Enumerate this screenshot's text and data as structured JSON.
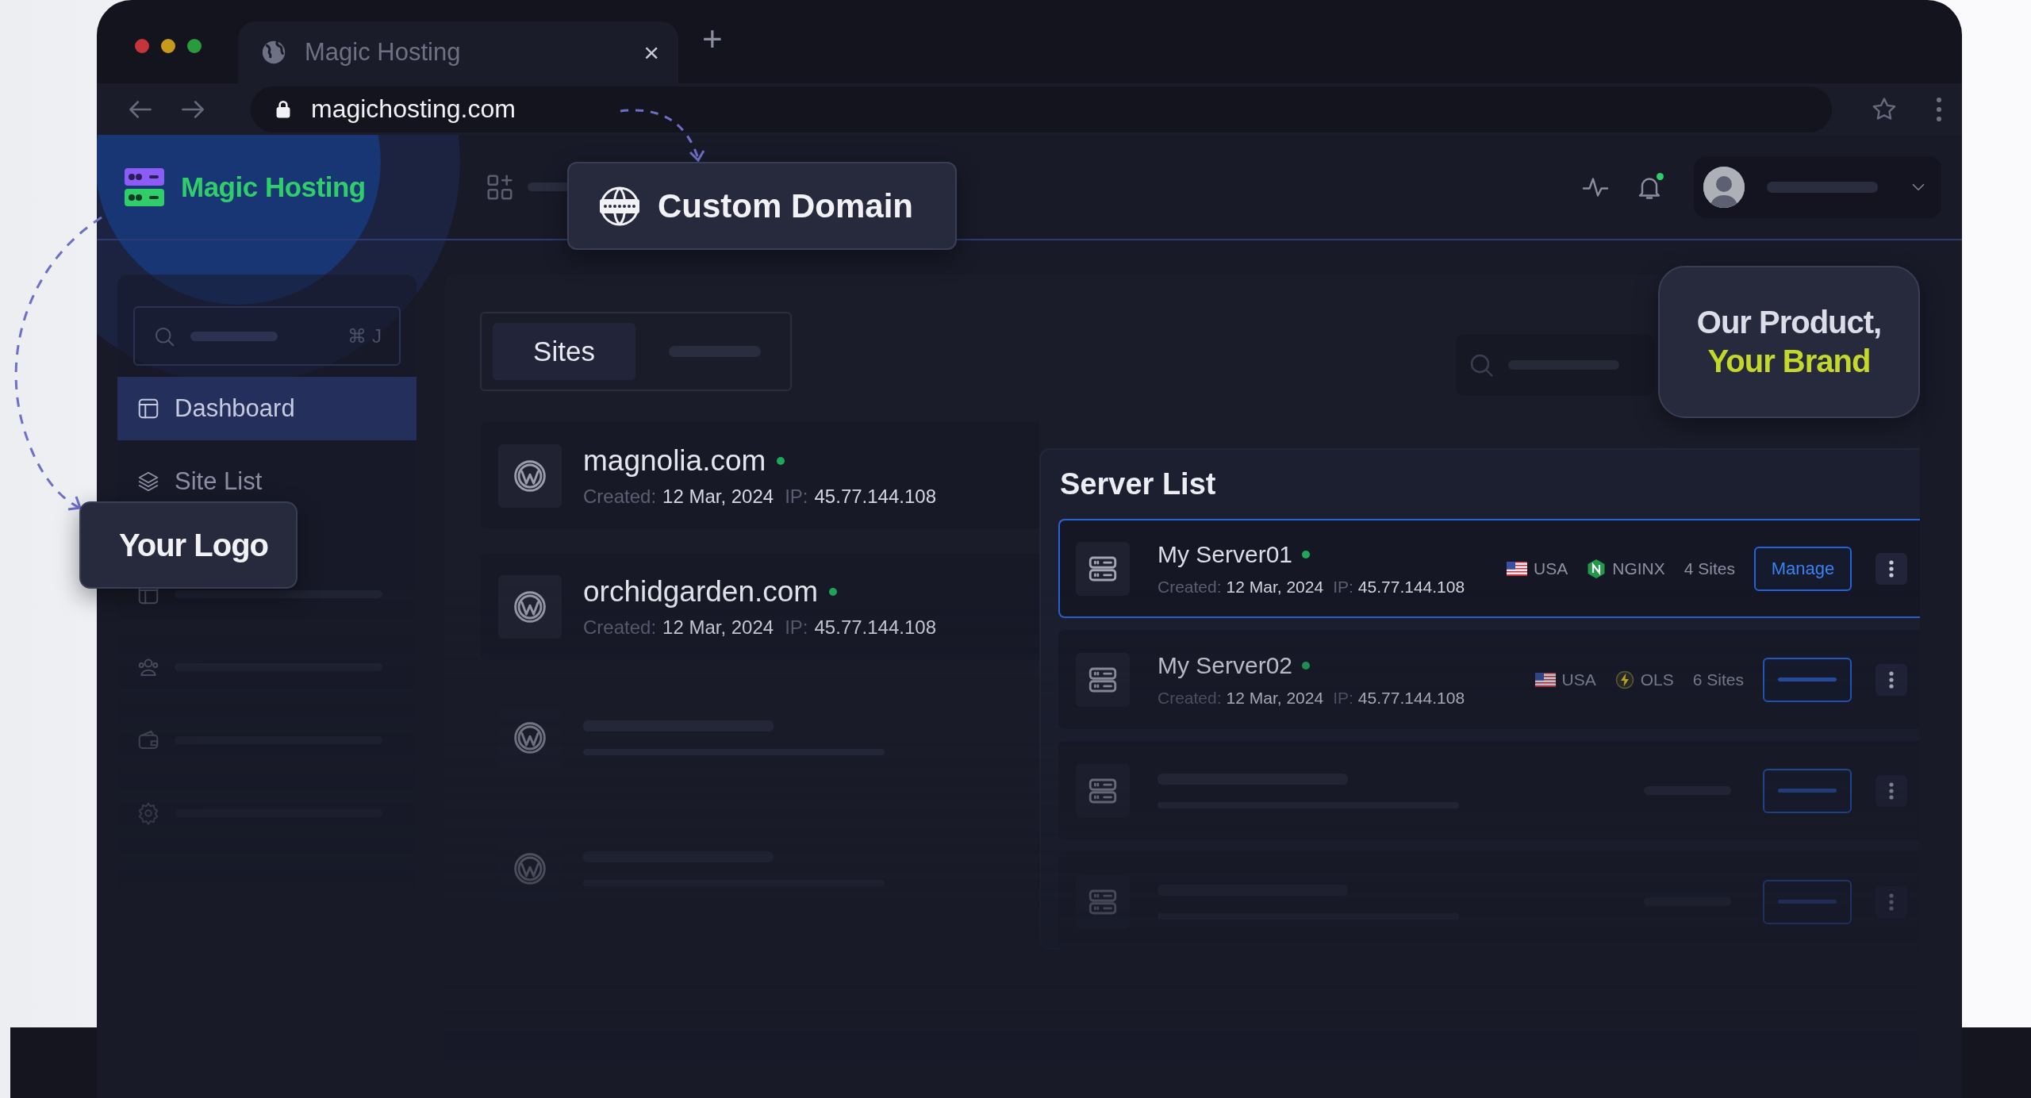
{
  "browser": {
    "tab_title": "Magic Hosting",
    "close": "×",
    "new_tab": "+",
    "url": "magichosting.com"
  },
  "header": {
    "brand": "Magic Hosting",
    "notification": true
  },
  "callouts": {
    "custom_domain": "Custom Domain",
    "logo": "Your Logo",
    "brand_line_1": "Our Product,",
    "brand_line_2": "Your Brand"
  },
  "sidebar": {
    "search_shortcut": "⌘ J",
    "items": [
      {
        "label": "Dashboard",
        "selected": true
      },
      {
        "label": "Site List",
        "selected": false
      },
      {
        "selected": false
      },
      {
        "selected": false
      },
      {
        "selected": false
      },
      {
        "selected": false
      }
    ]
  },
  "sites": {
    "tabs": [
      {
        "label": "Sites",
        "selected": true
      },
      {
        "selected": false
      }
    ],
    "rows": [
      {
        "kind": "site",
        "name": "magnolia.com",
        "online": true,
        "created_label": "Created:",
        "created": "12 Mar, 2024",
        "ip_label": "IP:",
        "ip": "45.77.144.108"
      },
      {
        "kind": "site",
        "name": "orchidgarden.com",
        "online": true,
        "created_label": "Created:",
        "created": "12 Mar, 2024",
        "ip_label": "IP:",
        "ip": "45.77.144.108"
      },
      {
        "kind": "placeholder"
      },
      {
        "kind": "placeholder"
      }
    ]
  },
  "server_list": {
    "title": "Server List",
    "rows": [
      {
        "kind": "server",
        "name": "My Server01",
        "online": true,
        "selected": true,
        "created_label": "Created:",
        "created": "12 Mar, 2024",
        "ip_label": "IP:",
        "ip": "45.77.144.108",
        "country": "USA",
        "stack": {
          "kind": "nginx",
          "label": "NGINX"
        },
        "sites": "4 Sites",
        "action": "Manage"
      },
      {
        "kind": "server",
        "name": "My Server02",
        "online": true,
        "selected": false,
        "created_label": "Created:",
        "created": "12 Mar, 2024",
        "ip_label": "IP:",
        "ip": "45.77.144.108",
        "country": "USA",
        "stack": {
          "kind": "ols",
          "label": "OLS"
        },
        "sites": "6 Sites"
      },
      {
        "kind": "placeholder",
        "selected": false
      },
      {
        "kind": "placeholder",
        "selected": false
      }
    ]
  }
}
